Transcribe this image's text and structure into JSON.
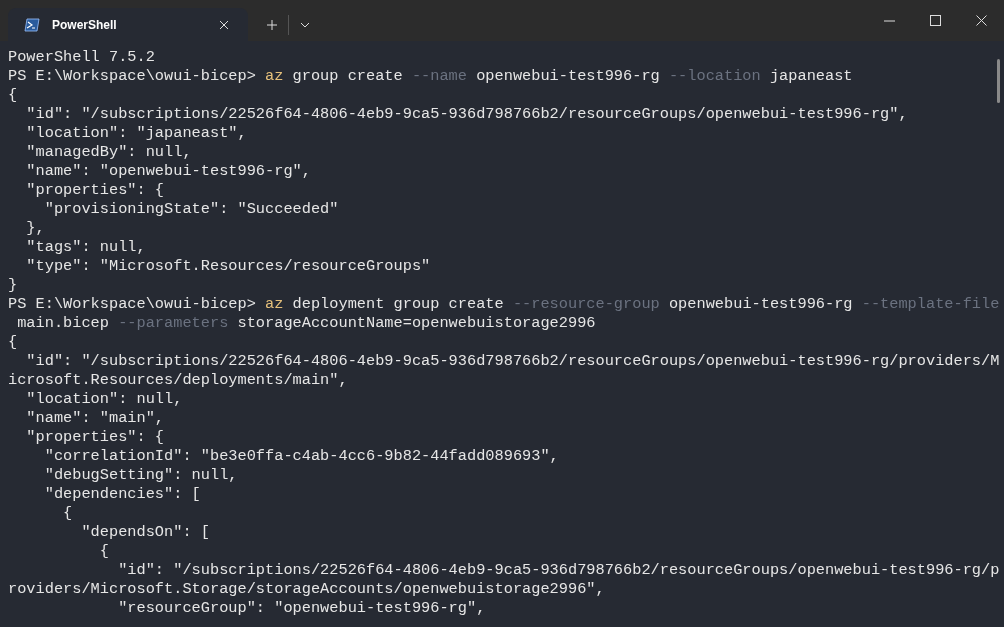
{
  "tabs": [
    {
      "title": "PowerShell",
      "selected": true
    }
  ],
  "terminal": {
    "lines": [
      [
        {
          "kind": "out",
          "text": "PowerShell 7.5.2"
        }
      ],
      [
        {
          "kind": "prompt",
          "text": "PS E:\\Workspace\\owui-bicep> "
        },
        {
          "kind": "command",
          "text": "az"
        },
        {
          "kind": "arg",
          "text": " group create "
        },
        {
          "kind": "flag",
          "text": "--name"
        },
        {
          "kind": "arg",
          "text": " openwebui-test996-rg "
        },
        {
          "kind": "flag",
          "text": "--location"
        },
        {
          "kind": "arg",
          "text": " japaneast"
        }
      ],
      [
        {
          "kind": "out",
          "text": "{"
        }
      ],
      [
        {
          "kind": "out",
          "text": "  \"id\": \"/subscriptions/22526f64-4806-4eb9-9ca5-936d798766b2/resourceGroups/openwebui-test996-rg\","
        }
      ],
      [
        {
          "kind": "out",
          "text": "  \"location\": \"japaneast\","
        }
      ],
      [
        {
          "kind": "out",
          "text": "  \"managedBy\": null,"
        }
      ],
      [
        {
          "kind": "out",
          "text": "  \"name\": \"openwebui-test996-rg\","
        }
      ],
      [
        {
          "kind": "out",
          "text": "  \"properties\": {"
        }
      ],
      [
        {
          "kind": "out",
          "text": "    \"provisioningState\": \"Succeeded\""
        }
      ],
      [
        {
          "kind": "out",
          "text": "  },"
        }
      ],
      [
        {
          "kind": "out",
          "text": "  \"tags\": null,"
        }
      ],
      [
        {
          "kind": "out",
          "text": "  \"type\": \"Microsoft.Resources/resourceGroups\""
        }
      ],
      [
        {
          "kind": "out",
          "text": "}"
        }
      ],
      [
        {
          "kind": "prompt",
          "text": "PS E:\\Workspace\\owui-bicep> "
        },
        {
          "kind": "command",
          "text": "az"
        },
        {
          "kind": "arg",
          "text": " deployment group create "
        },
        {
          "kind": "flag",
          "text": "--resource-group"
        },
        {
          "kind": "arg",
          "text": " openwebui-test996-rg "
        },
        {
          "kind": "flag",
          "text": "--template-file"
        }
      ],
      [
        {
          "kind": "arg",
          "text": " main.bicep "
        },
        {
          "kind": "flag",
          "text": "--parameters"
        },
        {
          "kind": "arg",
          "text": " storageAccountName=openwebuistorage2996"
        }
      ],
      [
        {
          "kind": "out",
          "text": "{"
        }
      ],
      [
        {
          "kind": "out",
          "text": "  \"id\": \"/subscriptions/22526f64-4806-4eb9-9ca5-936d798766b2/resourceGroups/openwebui-test996-rg/providers/M"
        }
      ],
      [
        {
          "kind": "out",
          "text": "icrosoft.Resources/deployments/main\","
        }
      ],
      [
        {
          "kind": "out",
          "text": "  \"location\": null,"
        }
      ],
      [
        {
          "kind": "out",
          "text": "  \"name\": \"main\","
        }
      ],
      [
        {
          "kind": "out",
          "text": "  \"properties\": {"
        }
      ],
      [
        {
          "kind": "out",
          "text": "    \"correlationId\": \"be3e0ffa-c4ab-4cc6-9b82-44fadd089693\","
        }
      ],
      [
        {
          "kind": "out",
          "text": "    \"debugSetting\": null,"
        }
      ],
      [
        {
          "kind": "out",
          "text": "    \"dependencies\": ["
        }
      ],
      [
        {
          "kind": "out",
          "text": "      {"
        }
      ],
      [
        {
          "kind": "out",
          "text": "        \"dependsOn\": ["
        }
      ],
      [
        {
          "kind": "out",
          "text": "          {"
        }
      ],
      [
        {
          "kind": "out",
          "text": "            \"id\": \"/subscriptions/22526f64-4806-4eb9-9ca5-936d798766b2/resourceGroups/openwebui-test996-rg/p"
        }
      ],
      [
        {
          "kind": "out",
          "text": "roviders/Microsoft.Storage/storageAccounts/openwebuistorage2996\","
        }
      ],
      [
        {
          "kind": "out",
          "text": "            \"resourceGroup\": \"openwebui-test996-rg\","
        }
      ]
    ]
  }
}
